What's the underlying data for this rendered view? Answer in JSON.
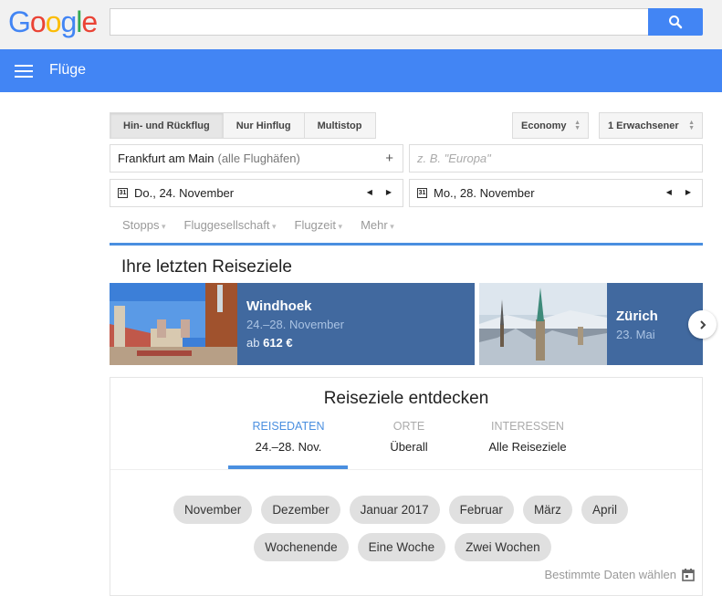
{
  "header": {
    "logo_letters": [
      {
        "ch": "G",
        "color": "#4285f4"
      },
      {
        "ch": "o",
        "color": "#ea4335"
      },
      {
        "ch": "o",
        "color": "#fbbc05"
      },
      {
        "ch": "g",
        "color": "#4285f4"
      },
      {
        "ch": "l",
        "color": "#34a853"
      },
      {
        "ch": "e",
        "color": "#ea4335"
      }
    ],
    "search_value": "",
    "search_icon": "search-icon"
  },
  "nav": {
    "title": "Flüge",
    "menu_icon": "hamburger-menu-icon"
  },
  "search_form": {
    "trip_types": [
      "Hin- und Rückflug",
      "Nur Hinflug",
      "Multistop"
    ],
    "trip_type_active": 0,
    "cabin_class": "Economy",
    "passengers": "1 Erwachsener",
    "origin": {
      "value": "Frankfurt am Main",
      "suffix": "(alle Flughäfen)",
      "add_icon": "+"
    },
    "destination": {
      "value": "",
      "placeholder": "z. B. \"Europa\""
    },
    "depart_date": {
      "calendar_label": "31",
      "value": "Do., 24. November"
    },
    "return_date": {
      "calendar_label": "31",
      "value": "Mo., 28. November"
    },
    "date_arrows": {
      "prev": "◀",
      "next": "▶"
    }
  },
  "filters": [
    "Stopps",
    "Fluggesellschaft",
    "Flugzeit",
    "Mehr"
  ],
  "recent": {
    "title": "Ihre letzten Reiseziele",
    "cards": [
      {
        "city": "Windhoek",
        "dates": "24.–28. November",
        "price_prefix": "ab",
        "price": "612 €"
      },
      {
        "city": "Zürich",
        "dates": "23. Mai"
      }
    ],
    "next_label": "›"
  },
  "explore": {
    "title": "Reiseziele entdecken",
    "tabs": [
      {
        "label": "REISEDATEN",
        "value": "24.–28. Nov."
      },
      {
        "label": "ORTE",
        "value": "Überall"
      },
      {
        "label": "INTERESSEN",
        "value": "Alle Reiseziele"
      }
    ],
    "active_tab": 0,
    "months": [
      "November",
      "Dezember",
      "Januar 2017",
      "Februar",
      "März",
      "April"
    ],
    "durations": [
      "Wochenende",
      "Eine Woche",
      "Zwei Wochen"
    ],
    "specific_dates": "Bestimmte Daten wählen"
  },
  "colors": {
    "brand_blue": "#4285f4",
    "accent_blue": "#4a8fe0",
    "card_blue": "#41699f"
  }
}
